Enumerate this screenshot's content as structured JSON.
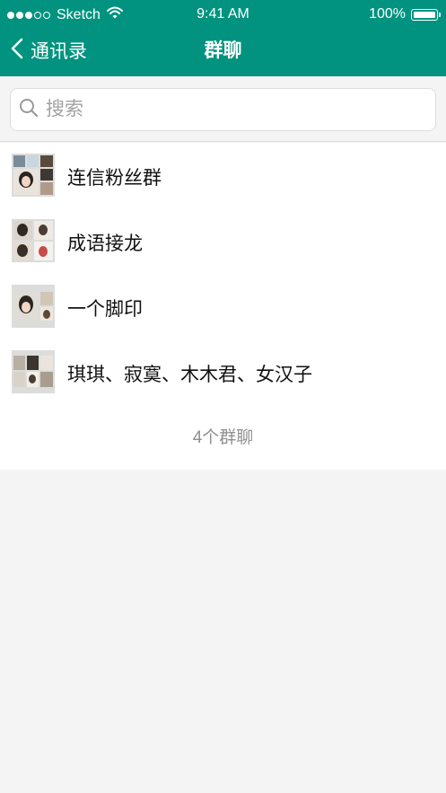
{
  "status_bar": {
    "carrier": "Sketch",
    "time": "9:41 AM",
    "battery": "100%",
    "signal_dots_filled": 3,
    "signal_dots_total": 5,
    "icons": [
      "signal-dots",
      "wifi-icon",
      "battery-icon"
    ]
  },
  "nav": {
    "back_label": "通讯录",
    "back_icon": "chevron-left-icon",
    "title": "群聊",
    "color": "#01937f"
  },
  "search": {
    "placeholder": "搜索",
    "value": "",
    "icon": "search-icon"
  },
  "groups": [
    {
      "name": "连信粉丝群",
      "member_avatars": 5
    },
    {
      "name": "成语接龙",
      "member_avatars": 4
    },
    {
      "name": "一个脚印",
      "member_avatars": 3
    },
    {
      "name": "琪琪、寂寞、木木君、女汉子",
      "member_avatars": 4
    }
  ],
  "footer": {
    "count_label": "4个群聊"
  }
}
